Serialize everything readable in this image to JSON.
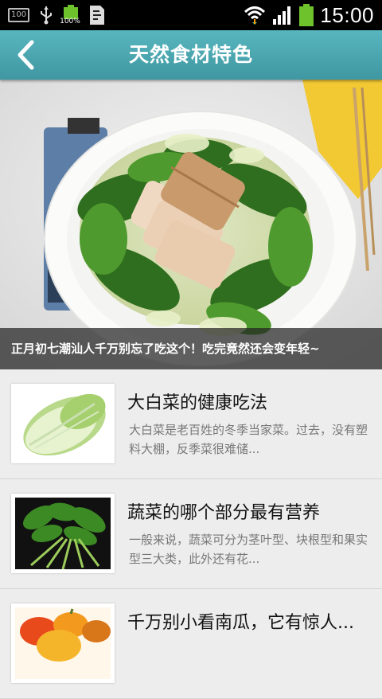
{
  "status_bar": {
    "battery_box_label": "100",
    "battery_percent_label": "100%",
    "time": "15:00"
  },
  "header": {
    "title": "天然食材特色",
    "back_icon": "chevron-left-icon"
  },
  "banner": {
    "caption": "正月初七潮汕人千万别忘了吃这个！吃完竟然还会变年轻~"
  },
  "articles": [
    {
      "title": "大白菜的健康吃法",
      "description": "大白菜是老百姓的冬季当家菜。过去，没有塑料大棚，反季菜很难储...",
      "thumb_icon": "napa-cabbage-image"
    },
    {
      "title": "蔬菜的哪个部分最有营养",
      "description": "一般来说，蔬菜可分为茎叶型、块根型和果实型三大类，此外还有花...",
      "thumb_icon": "leafy-greens-image"
    },
    {
      "title": "千万别小看南瓜，它有惊人...",
      "description": "",
      "thumb_icon": "pumpkin-image"
    }
  ],
  "colors": {
    "header": "#4aa7b1",
    "list_background": "#ededed"
  }
}
